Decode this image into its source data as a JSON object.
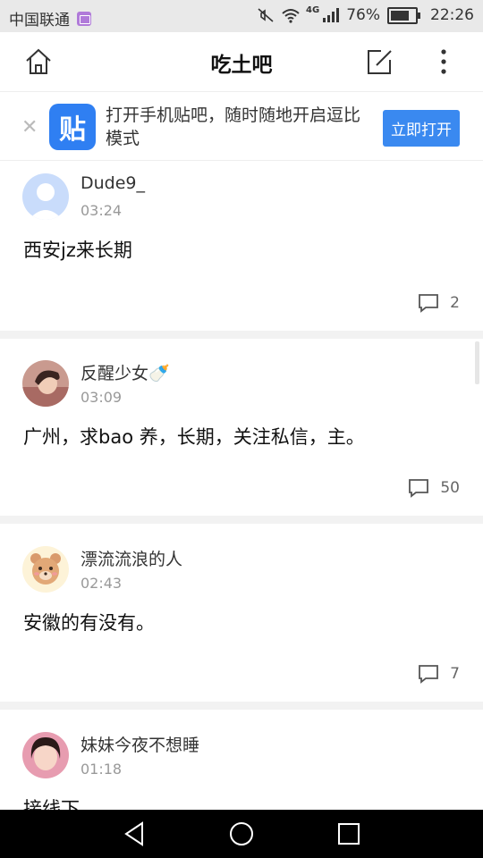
{
  "status_bar": {
    "carrier": "中国联通",
    "network": "4G",
    "battery": "76%",
    "time": "22:26"
  },
  "header": {
    "title": "吃土吧"
  },
  "banner": {
    "text": "打开手机贴吧，随时随地开启逗比模式",
    "logo_text": "贴",
    "button_label": "立即打开"
  },
  "posts": [
    {
      "username": "Dude9_",
      "time": "03:24",
      "content": "西安jz来长期",
      "comments": "2"
    },
    {
      "username": "反醒少女🍼",
      "time": "03:09",
      "content": "广州，求bao 养，长期，关注私信，主。",
      "comments": "50"
    },
    {
      "username": "漂流流浪的人",
      "time": "02:43",
      "content": "安徽的有没有。",
      "comments": "7"
    },
    {
      "username": "妹妹今夜不想睡",
      "time": "01:18",
      "content": "接线下"
    }
  ],
  "colors": {
    "accent": "#3a89f0",
    "separator": "#f2f2f2",
    "status_bar_bg": "#e9e9e9",
    "nav_bar_bg": "#000000"
  }
}
